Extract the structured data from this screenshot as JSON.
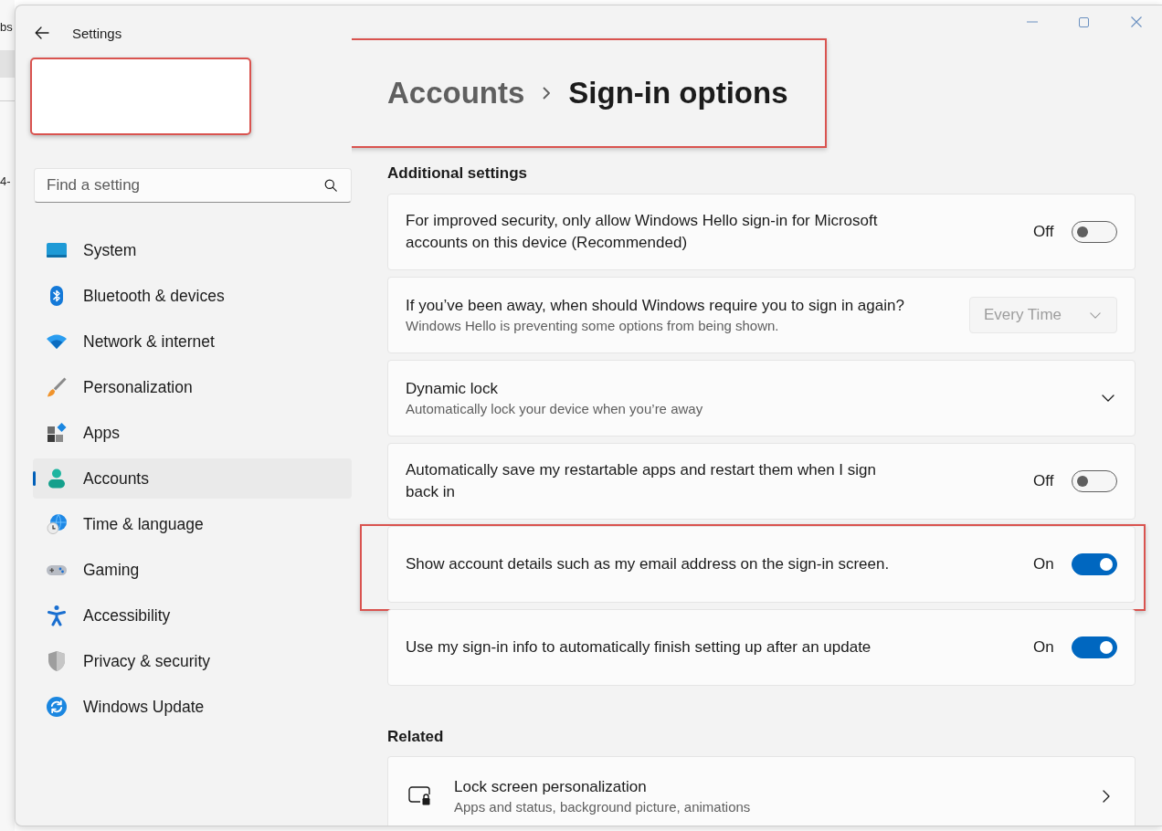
{
  "background_window": {
    "fragments": [
      "bs",
      "4-"
    ]
  },
  "window": {
    "title": "Settings"
  },
  "profile": {
    "redacted": true
  },
  "search": {
    "placeholder": "Find a setting"
  },
  "sidebar": {
    "items": [
      {
        "label": "System",
        "selected": false
      },
      {
        "label": "Bluetooth & devices",
        "selected": false
      },
      {
        "label": "Network & internet",
        "selected": false
      },
      {
        "label": "Personalization",
        "selected": false
      },
      {
        "label": "Apps",
        "selected": false
      },
      {
        "label": "Accounts",
        "selected": true
      },
      {
        "label": "Time & language",
        "selected": false
      },
      {
        "label": "Gaming",
        "selected": false
      },
      {
        "label": "Accessibility",
        "selected": false
      },
      {
        "label": "Privacy & security",
        "selected": false
      },
      {
        "label": "Windows Update",
        "selected": false
      }
    ]
  },
  "header": {
    "parent": "Accounts",
    "title": "Sign-in options",
    "highlighted": true
  },
  "additional_settings": {
    "heading": "Additional settings",
    "items": [
      {
        "kind": "toggle",
        "title": "For improved security, only allow Windows Hello sign-in for Microsoft accounts on this device (Recommended)",
        "on": false,
        "state_label": "Off",
        "highlighted": false
      },
      {
        "kind": "dropdown",
        "title": "If you’ve been away, when should Windows require you to sign in again?",
        "description": "Windows Hello is preventing some options from being shown.",
        "value": "Every Time",
        "disabled": true,
        "highlighted": false
      },
      {
        "kind": "expander",
        "title": "Dynamic lock",
        "description": "Automatically lock your device when you’re away",
        "expanded": false,
        "highlighted": false
      },
      {
        "kind": "toggle",
        "title": "Automatically save my restartable apps and restart them when I sign back in",
        "on": false,
        "state_label": "Off",
        "highlighted": false
      },
      {
        "kind": "toggle",
        "title": "Show account details such as my email address on the sign-in screen.",
        "on": true,
        "state_label": "On",
        "highlighted": true
      },
      {
        "kind": "toggle",
        "title": "Use my sign-in info to automatically finish setting up after an update",
        "on": true,
        "state_label": "On",
        "highlighted": false
      }
    ]
  },
  "related": {
    "heading": "Related",
    "items": [
      {
        "kind": "link",
        "title": "Lock screen personalization",
        "description": "Apps and status, background picture, animations"
      }
    ]
  }
}
